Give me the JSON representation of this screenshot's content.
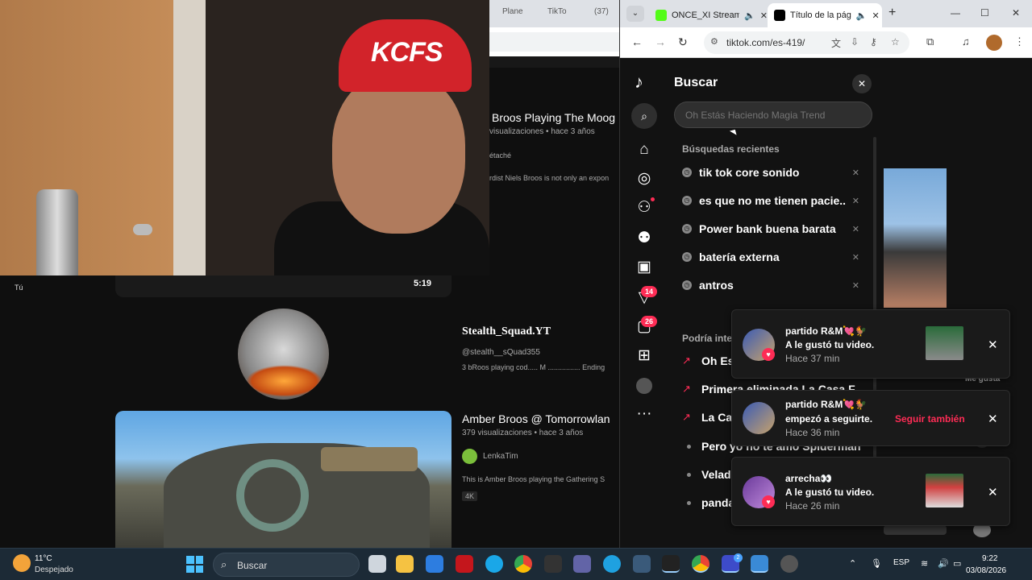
{
  "youtube": {
    "side_you_label": "Tú",
    "duration": "5:19",
    "video1": {
      "title": "Broos Playing The Moog",
      "meta": "visualizaciones • hace 3 años",
      "desc1": "étaché",
      "desc2": "rdist Niels Broos is not only an expon"
    },
    "channel": {
      "name": "Stealth_Squad.YT",
      "handle": "@stealth__sQuad355",
      "desc": "3 bRoos playing cod..... M ................ Ending"
    },
    "video2": {
      "title": "Amber Broos @ Tomorrowlan",
      "meta": "379 visualizaciones • hace 3 años",
      "channel": "LenkaTim",
      "desc": "This is Amber Broos playing the Gathering S",
      "badge": "4K"
    }
  },
  "background_chrome": {
    "tabs": [
      "Plane",
      "TikTo",
      "(37)"
    ]
  },
  "chrome": {
    "tabs": [
      {
        "label": "ONCE_XI Stream",
        "fav_color": "#53fc18"
      },
      {
        "label": "Título de la pág",
        "fav_color": "#000000"
      }
    ],
    "url": "tiktok.com/es-419/",
    "win_controls": {
      "minimize": "—",
      "maximize": "☐",
      "close": "✕"
    }
  },
  "tiktok": {
    "nav_counts": {
      "activity": "14",
      "messages": "26"
    },
    "search": {
      "title": "Buscar",
      "placeholder": "Oh Estás Haciendo Magia Trend",
      "recent_title": "Búsquedas recientes",
      "recent": [
        "tik tok core sonido",
        "es que no me tienen pacie...",
        "Power bank buena barata",
        "batería externa",
        "antros"
      ],
      "suggest_title": "Podría inter",
      "suggestions": [
        {
          "text": "Oh Est",
          "trending": true
        },
        {
          "text": "Primera eliminada La Casa F",
          "trending": true
        },
        {
          "text": "La Cas",
          "trending": true
        },
        {
          "text": "Pero yo no te amo Spiderman",
          "trending": false
        },
        {
          "text": "Velada",
          "trending": false
        },
        {
          "text": "panda",
          "trending": false
        }
      ]
    },
    "feed_like_label": "Me gusta"
  },
  "notifications": [
    {
      "name": "partido R&M💘🐓",
      "message": "A le gustó tu video.",
      "time": "Hace 37 min",
      "type": "like"
    },
    {
      "name": "partido R&M💘🐓",
      "message": "empezó a seguirte.",
      "time": "Hace 36 min",
      "type": "follow",
      "action": "Seguir también"
    },
    {
      "name": "arrecha👀",
      "message": "A le gustó tu video.",
      "time": "Hace 26 min",
      "type": "like"
    }
  ],
  "taskbar": {
    "temp": "11°C",
    "weather": "Despejado",
    "search_label": "Buscar",
    "lang": "ESP",
    "time": "9:22",
    "date": "03/08/2026",
    "copilot_badge": "2"
  }
}
